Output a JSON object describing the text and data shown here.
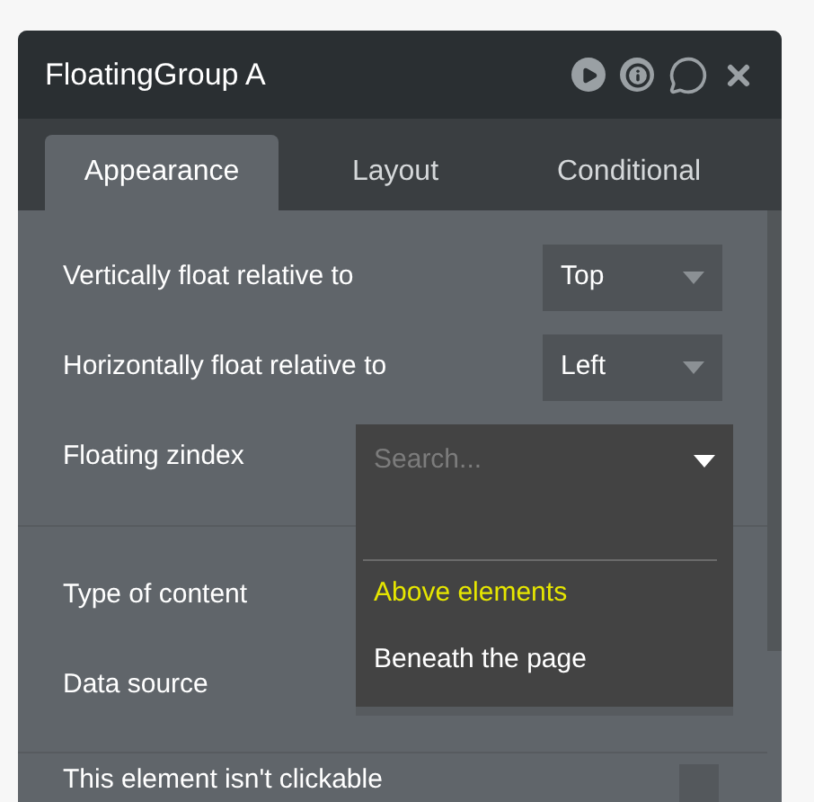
{
  "window": {
    "title": "FloatingGroup A"
  },
  "tabs": [
    {
      "label": "Appearance",
      "selected": true
    },
    {
      "label": "Layout",
      "selected": false
    },
    {
      "label": "Conditional",
      "selected": false
    }
  ],
  "rows": [
    {
      "label": "Vertically float relative to",
      "value": "Top"
    },
    {
      "label": "Horizontally float relative to",
      "value": "Left"
    }
  ],
  "zindex": {
    "label": "Floating zindex",
    "placeholder": "Search...",
    "options": [
      {
        "label": "Above elements",
        "selected": true
      },
      {
        "label": "Beneath the page",
        "selected": false
      }
    ]
  },
  "content_rows": [
    {
      "label": "Type of content"
    },
    {
      "label": "Data source"
    }
  ],
  "checkbox_row": {
    "label": "This element isn't clickable",
    "checked": false
  }
}
